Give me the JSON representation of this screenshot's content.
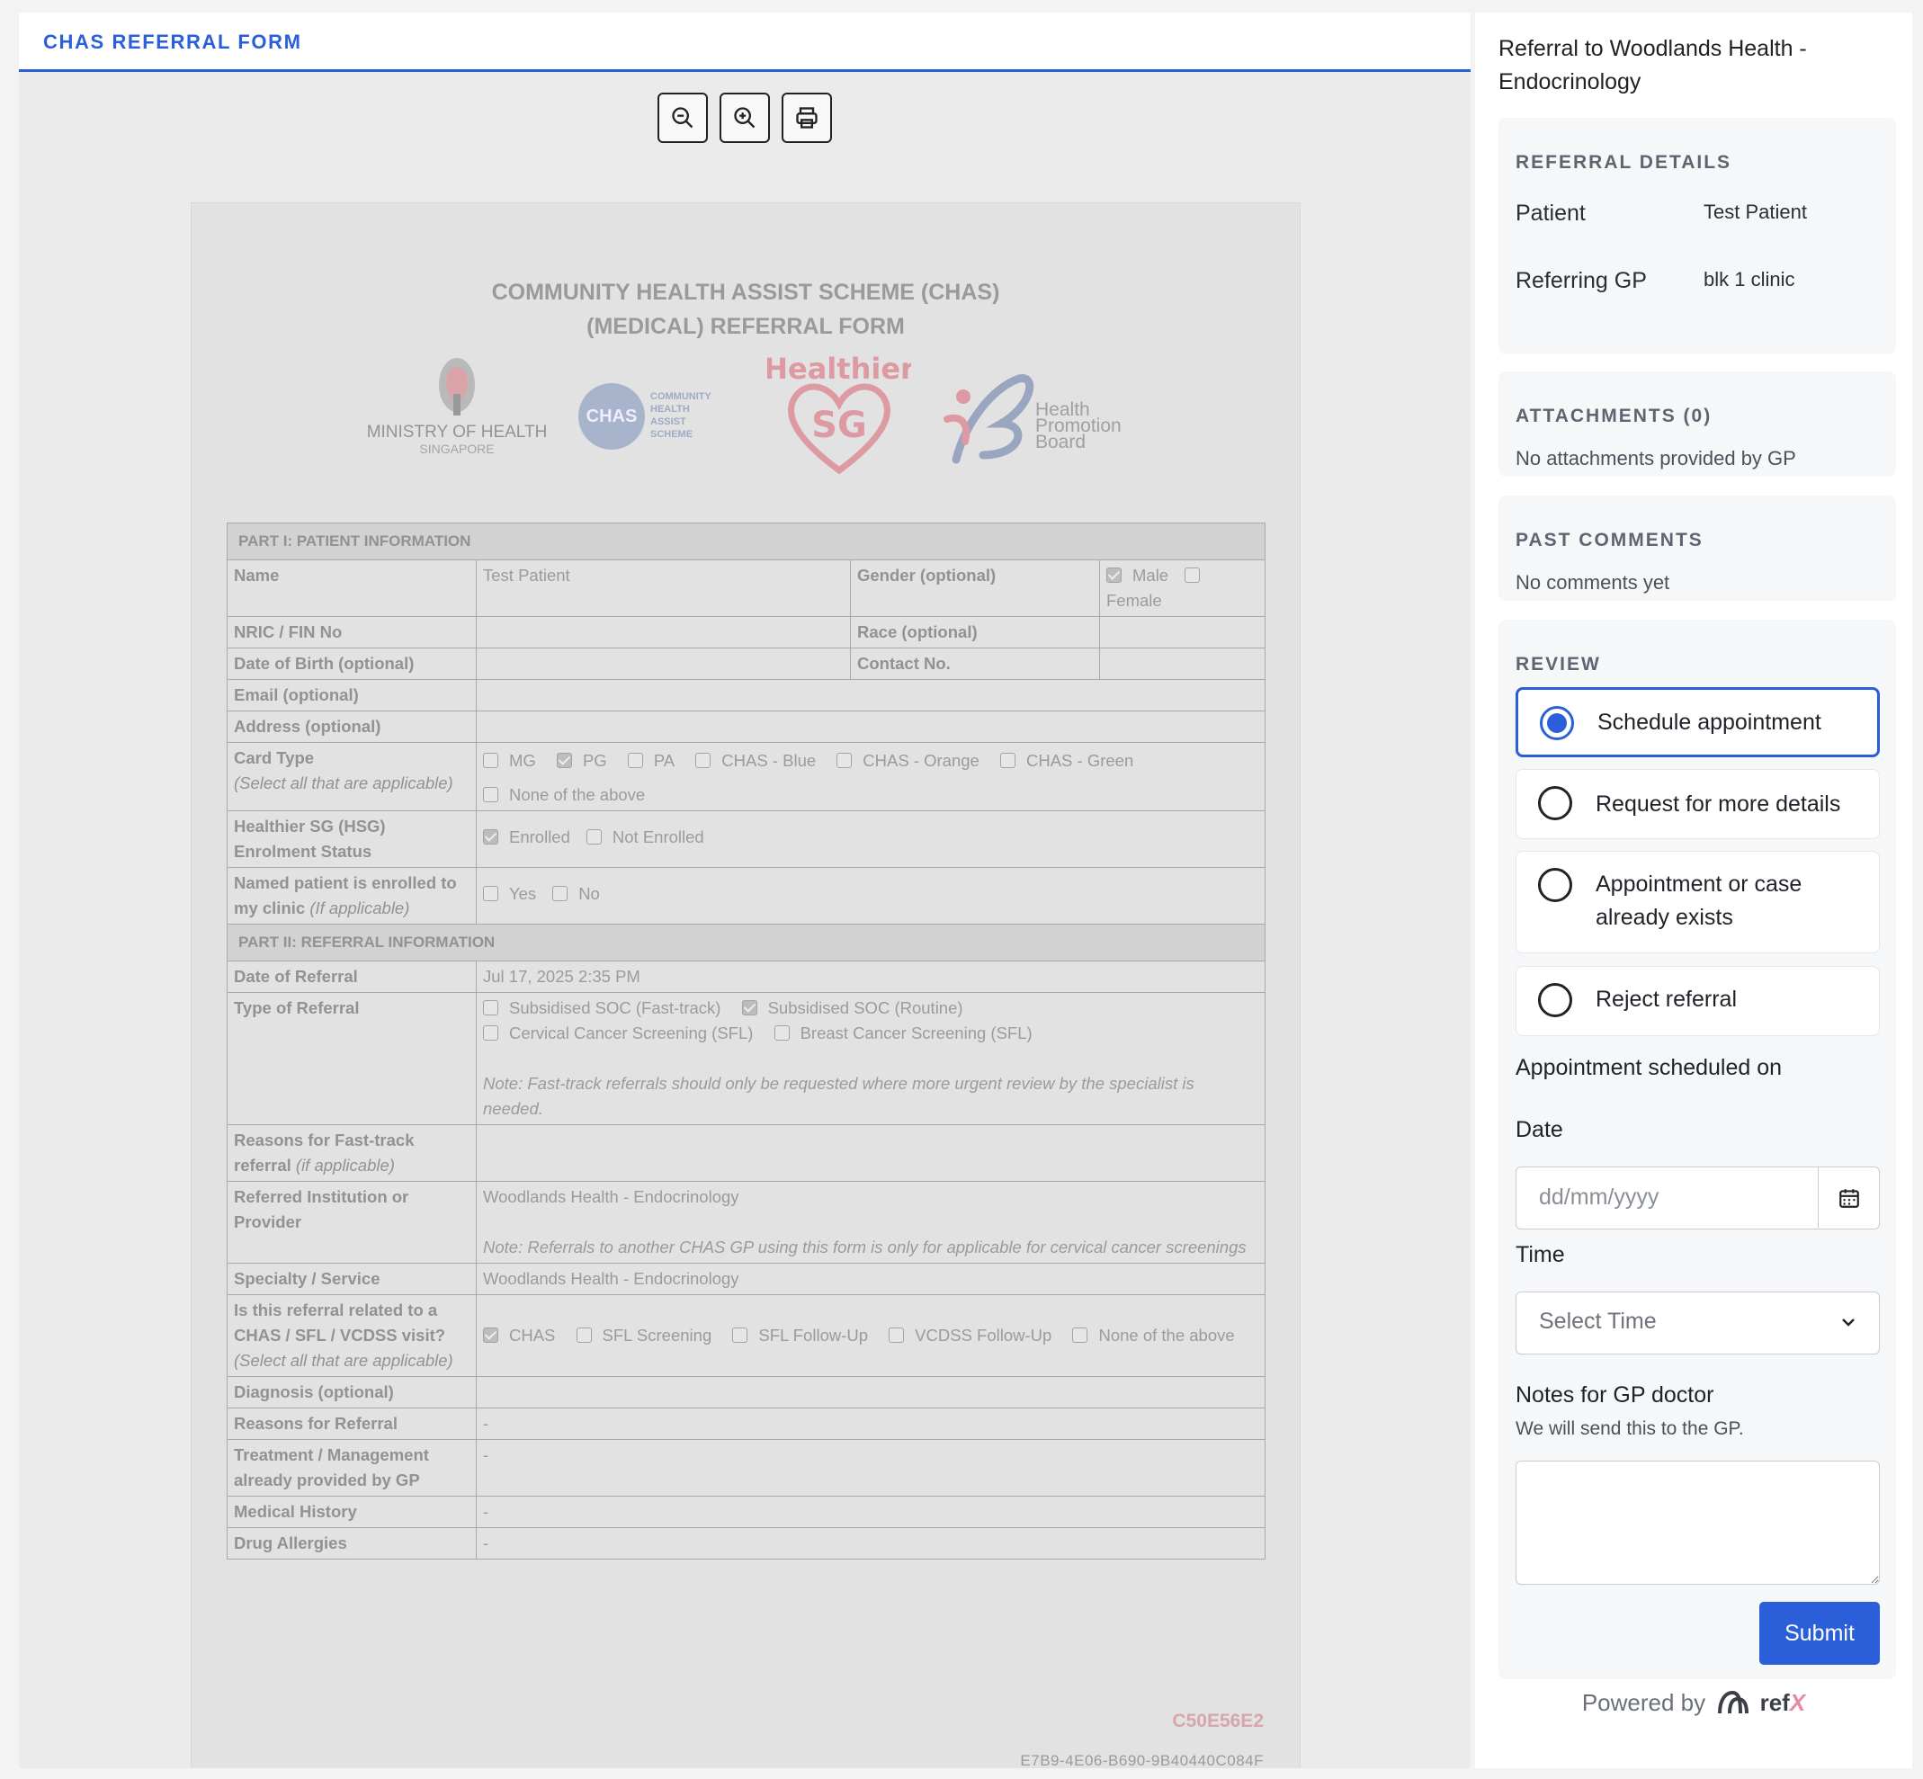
{
  "tab": {
    "title": "CHAS REFERRAL FORM"
  },
  "toolbar": {
    "zoom_out": "zoom-out-icon",
    "zoom_in": "zoom-in-icon",
    "print": "print-icon"
  },
  "form": {
    "title_line1": "COMMUNITY HEALTH ASSIST SCHEME (CHAS)",
    "title_line2": "(MEDICAL) REFERRAL FORM",
    "logos": {
      "moh_line1": "MINISTRY OF HEALTH",
      "moh_line2": "SINGAPORE",
      "chas_badge": "CHAS",
      "chas_text": [
        "COMMUNITY",
        "HEALTH",
        "ASSIST",
        "SCHEME"
      ],
      "hsg_arc": "Healthier",
      "hsg_sg": "SG",
      "hpb_text": [
        "Health",
        "Promotion",
        "Board"
      ]
    },
    "part1": "PART I: PATIENT INFORMATION",
    "name_label": "Name",
    "name_value": "Test Patient",
    "gender_label": "Gender (optional)",
    "gender_male": "Male",
    "gender_female": "Female",
    "nric_label": "NRIC / FIN No",
    "race_label": "Race (optional)",
    "dob_label": "Date of Birth (optional)",
    "contact_label": "Contact No.",
    "email_label": "Email (optional)",
    "address_label": "Address (optional)",
    "card_label": "Card Type",
    "card_sub": "(Select all that are applicable)",
    "card_options": {
      "mg": "MG",
      "pg": "PG",
      "pa": "PA",
      "blue": "CHAS - Blue",
      "orange": "CHAS - Orange",
      "green": "CHAS - Green",
      "none": "None of the above"
    },
    "hsg_label": "Healthier SG (HSG) Enrolment Status",
    "hsg_enrolled": "Enrolled",
    "hsg_not": "Not Enrolled",
    "named_label": "Named patient is enrolled to my clinic",
    "named_sub": "(If applicable)",
    "yes": "Yes",
    "no": "No",
    "part2": "PART II: REFERRAL INFORMATION",
    "date_label": "Date of Referral",
    "date_value": "Jul 17, 2025 2:35 PM",
    "type_label": "Type of Referral",
    "type_fast": "Subsidised SOC (Fast-track)",
    "type_routine": "Subsidised SOC (Routine)",
    "type_cervical": "Cervical Cancer Screening (SFL)",
    "type_breast": "Breast Cancer Screening (SFL)",
    "type_note": "Note: Fast-track referrals should only be requested where more urgent review by the specialist is needed.",
    "fast_label": "Reasons for Fast-track referral",
    "fast_sub": "(if applicable)",
    "inst_label": "Referred Institution or Provider",
    "inst_value": "Woodlands Health - Endocrinology",
    "inst_note": "Note: Referrals to another CHAS GP using this form is only for applicable for cervical cancer screenings",
    "spec_label": "Specialty / Service",
    "spec_value": "Woodlands Health - Endocrinology",
    "related_label": "Is this referral related to a CHAS / SFL / VCDSS visit?",
    "related_sub": "(Select all that are applicable)",
    "related_options": {
      "chas": "CHAS",
      "sfl_screen": "SFL Screening",
      "sfl_follow": "SFL Follow-Up",
      "vcdss": "VCDSS Follow-Up",
      "none": "None of the above"
    },
    "diag_label": "Diagnosis (optional)",
    "reasons_label": "Reasons for Referral",
    "reasons_value": "-",
    "treat_label": "Treatment / Management already provided by GP",
    "treat_value": "-",
    "history_label": "Medical History",
    "history_value": "-",
    "allergy_label": "Drug Allergies",
    "allergy_value": "-",
    "code": "C50E56E2",
    "uuid": "E7B9-4E06-B690-9B40440C084F"
  },
  "panel": {
    "title": "Referral to Woodlands Health - Endocrinology",
    "details_header": "REFERRAL DETAILS",
    "patient_label": "Patient",
    "patient_value": "Test Patient",
    "gp_label": "Referring GP",
    "gp_value": "blk 1 clinic",
    "attach_header": "ATTACHMENTS (0)",
    "attach_text": "No attachments provided by GP",
    "comments_header": "PAST COMMENTS",
    "comments_text": "No comments yet",
    "review_header": "REVIEW",
    "options": {
      "schedule": "Schedule appointment",
      "more": "Request for more details",
      "exists": "Appointment or case already exists",
      "reject": "Reject referral"
    },
    "scheduled_label": "Appointment scheduled on",
    "date_label": "Date",
    "date_placeholder": "dd/mm/yyyy",
    "time_label": "Time",
    "time_value": "Select Time",
    "notes_label": "Notes for GP doctor",
    "notes_hint": "We will send this to the GP.",
    "submit": "Submit",
    "powered": "Powered by",
    "brand": "ref",
    "brand_x": "X"
  },
  "colors": {
    "accent": "#2b5fd9",
    "brand_pink": "#e58ba1"
  }
}
